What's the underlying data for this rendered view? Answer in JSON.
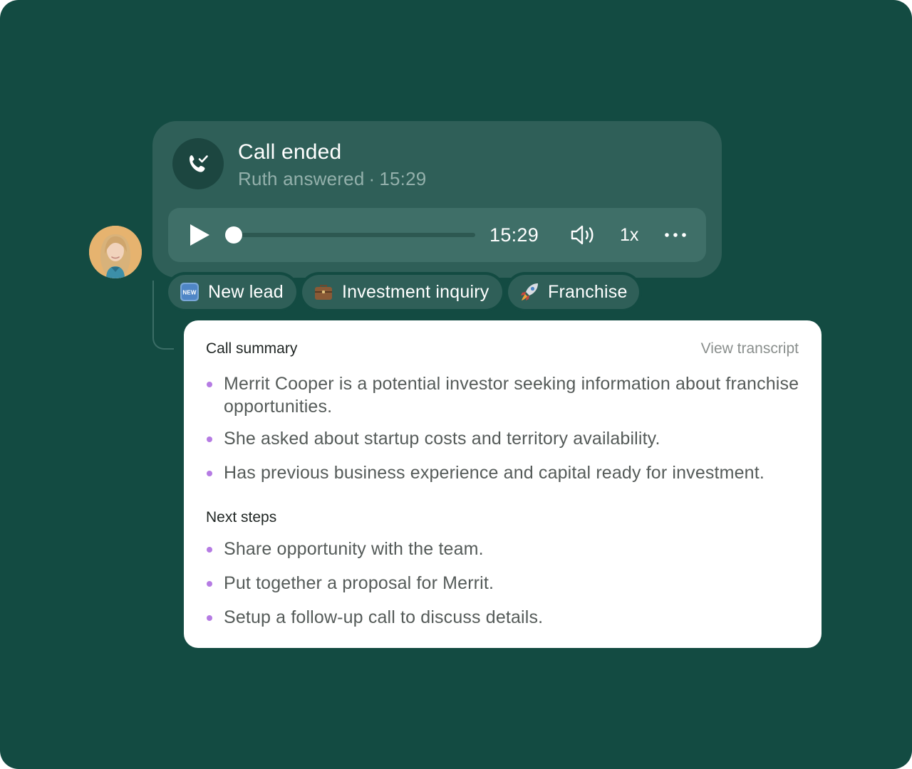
{
  "call": {
    "title": "Call ended",
    "answered_by": "Ruth answered",
    "separator": "·",
    "duration": "15:29",
    "icon": "phone-check-icon"
  },
  "player": {
    "time": "15:29",
    "speed": "1x",
    "progress": 0.0,
    "play_icon": "play-icon",
    "volume_icon": "volume-icon",
    "more_icon": "more-horizontal-icon"
  },
  "tags": [
    {
      "label": "New lead",
      "icon": "new-badge-icon"
    },
    {
      "label": "Investment inquiry",
      "icon": "briefcase-icon"
    },
    {
      "label": "Franchise",
      "icon": "rocket-icon"
    }
  ],
  "summary": {
    "heading": "Call summary",
    "view_transcript": "View transcript",
    "points": [
      "Merrit Cooper is a potential investor seeking information about franchise opportunities.",
      "She asked about startup costs and territory availability.",
      "Has previous business experience and capital ready for investment."
    ],
    "next_heading": "Next steps",
    "next_steps": [
      "Share opportunity with the team.",
      "Put together a proposal for Merrit.",
      "Setup a follow-up call to discuss details."
    ]
  },
  "colors": {
    "background": "#134b42",
    "card": "#2f5f58",
    "bullet": "#b57be3"
  }
}
